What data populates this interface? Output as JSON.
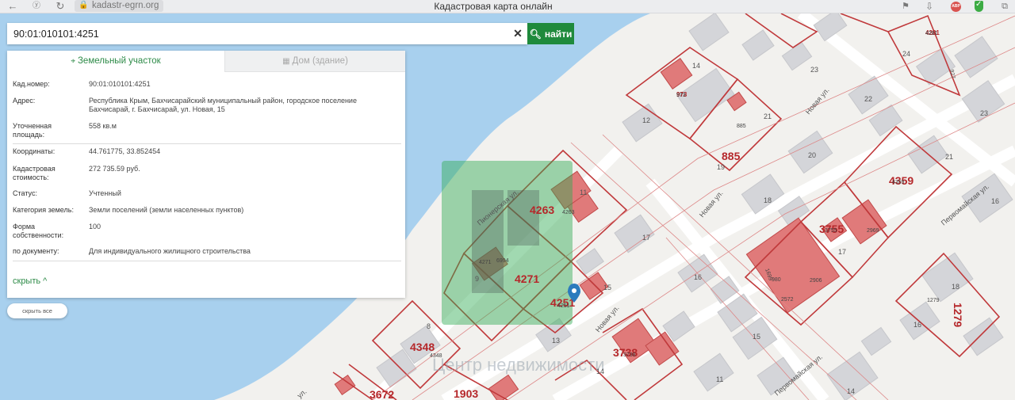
{
  "browser": {
    "url": "kadastr-egrn.org",
    "title": "Кадастровая карта онлайн"
  },
  "search": {
    "value": "90:01:010101:4251",
    "button_label": "найти"
  },
  "panel": {
    "tabs": [
      "Земельный участок",
      "Дом (здание)"
    ],
    "rows": [
      {
        "label": "Кад.номер:",
        "value": "90:01:010101:4251"
      },
      {
        "label": "Адрес:",
        "value": "Республика Крым, Бахчисарайский муниципальный район, городское поселение Бахчисарай, г. Бахчисарай, ул. Новая, 15"
      },
      {
        "label": "Уточненная площадь:",
        "value": "558 кв.м"
      },
      {
        "label": "Координаты:",
        "value": "44.761775, 33.852454"
      },
      {
        "label": "Кадастровая стоимость:",
        "value": "272 735.59 руб."
      },
      {
        "label": "Статус:",
        "value": "Учтенный"
      },
      {
        "label": "Категория земель:",
        "value": "Земли поселений (земли населенных пунктов)"
      },
      {
        "label": "Форма собственности:",
        "value": "100"
      },
      {
        "label": "по документу:",
        "value": "Для индивидуального жилищного строительства"
      }
    ],
    "hide_label": "скрыть",
    "hide_all_label": "скрыть все"
  },
  "map": {
    "streets": [
      "Новая ул.",
      "Новая ул.",
      "Новая ул.",
      "Первомайская ул.",
      "Первомайская ул.",
      "Пионерская ул.",
      "ул."
    ],
    "plot_numbers": [
      "4263",
      "4271",
      "4251",
      "4348",
      "3672",
      "4359",
      "3755",
      "3738",
      "1279",
      "4281",
      "885",
      "973",
      "1903"
    ],
    "small_labels": [
      "4263",
      "4271",
      "4251",
      "4348",
      "4359",
      "3755",
      "2969",
      "1699",
      "2906",
      "2572",
      "980",
      "3738",
      "1279",
      "885",
      "973",
      "6994",
      "4281",
      "927"
    ],
    "house_numbers": [
      "11",
      "17",
      "9",
      "15",
      "13",
      "8",
      "12",
      "14",
      "21",
      "23",
      "24",
      "22",
      "20",
      "18",
      "16",
      "17",
      "16",
      "15",
      "11",
      "14",
      "18",
      "16",
      "14",
      "21",
      "23",
      "19"
    ],
    "watermark": "Центр недвижимости",
    "colors": {
      "water": "#a8d0ee",
      "land": "#f2f1ee",
      "building": "#d4d5d9",
      "parcel": "#c0393b",
      "parcel_fill": "#e07a7a",
      "accent": "#1f8a3c"
    }
  }
}
